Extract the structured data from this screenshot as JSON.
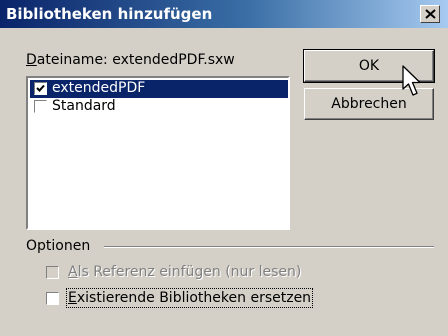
{
  "dialog": {
    "title": "Bibliotheken hinzufügen",
    "close_icon": "close-icon"
  },
  "filename": {
    "label_accesskey": "D",
    "label_rest": "ateiname: extendedPDF.sxw"
  },
  "libraries": [
    {
      "name": "extendedPDF",
      "checked": true,
      "selected": true
    },
    {
      "name": "Standard",
      "checked": false,
      "selected": false
    }
  ],
  "buttons": {
    "ok": "OK",
    "cancel": "Abbrechen"
  },
  "options": {
    "heading": "Optionen",
    "as_reference_accesskey": "A",
    "as_reference_rest": "ls Referenz einfügen (nur lesen)",
    "as_reference_enabled": false,
    "replace_accesskey": "E",
    "replace_rest": "xistierende Bibliotheken ersetzen",
    "replace_checked": false
  },
  "cursor": "arrow-pointer-icon"
}
